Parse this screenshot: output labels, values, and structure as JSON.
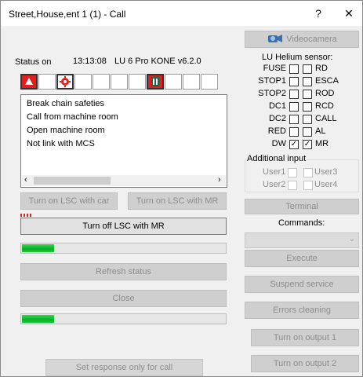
{
  "window": {
    "title": "Street,House,ent 1 (1) - Call",
    "help_label": "?",
    "close_label": "✕"
  },
  "status": {
    "label": "Status on",
    "time": "13:13:08",
    "version": "LU 6 Pro KONE v6.2.0",
    "icons": [
      "alarm-bell-icon",
      "",
      "gear-alarm-icon",
      "",
      "",
      "",
      "",
      "pause-icon",
      "",
      "",
      ""
    ]
  },
  "messages": [
    "Break chain safeties",
    "Call from machine room",
    "Open machine room",
    "Not link with MCS"
  ],
  "buttons": {
    "lsc_car": "Turn on LSC with car",
    "lsc_mr_on": "Turn on LSC with MR",
    "lsc_mr_off": "Turn off LSC with MR",
    "refresh": "Refresh status",
    "close": "Close",
    "response": "Set response only for call",
    "videocamera": "Videocamera",
    "terminal": "Terminal",
    "execute": "Execute",
    "suspend": "Suspend service",
    "errors": "Errors cleaning",
    "output1": "Turn on output 1",
    "output2": "Turn on output 2"
  },
  "progress": {
    "bar1": 0.16,
    "bar2": 0.16
  },
  "sensor": {
    "title": "LU Helium sensor:",
    "left": [
      {
        "label": "FUSE",
        "checked": false
      },
      {
        "label": "STOP1",
        "checked": false
      },
      {
        "label": "STOP2",
        "checked": false
      },
      {
        "label": "DC1",
        "checked": false
      },
      {
        "label": "DC2",
        "checked": false
      },
      {
        "label": "RED",
        "checked": false
      },
      {
        "label": "DW",
        "checked": true
      }
    ],
    "right": [
      {
        "label": "RD",
        "checked": false
      },
      {
        "label": "ESCA",
        "checked": false
      },
      {
        "label": "ROD",
        "checked": false
      },
      {
        "label": "RCD",
        "checked": false
      },
      {
        "label": "CALL",
        "checked": false
      },
      {
        "label": "AL",
        "checked": false
      },
      {
        "label": "MR",
        "checked": true
      }
    ]
  },
  "additional_input": {
    "title": "Additional input",
    "user1": "User1",
    "user2": "User2",
    "user3": "User3",
    "user4": "User4"
  },
  "commands": {
    "label": "Commands:",
    "selected": ""
  },
  "colors": {
    "progress_green": "#06b025",
    "alarm_red": "#e02020"
  }
}
